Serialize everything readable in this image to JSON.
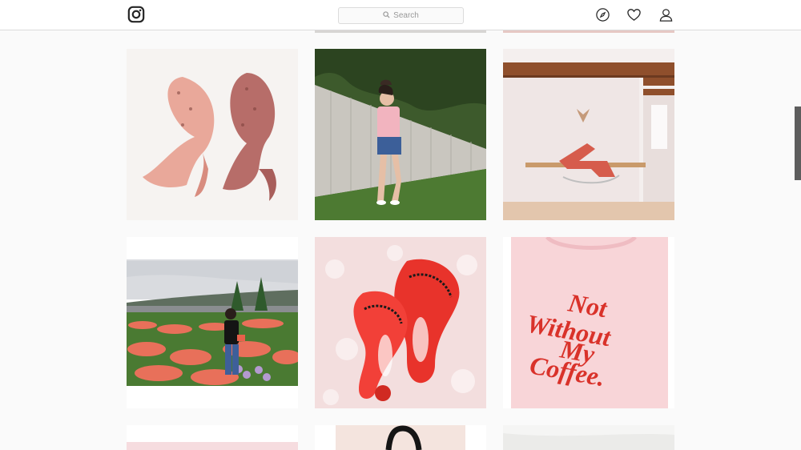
{
  "header": {
    "logo_icon": "instagram-logo-icon",
    "search_placeholder": "Search",
    "nav_icons": [
      "explore-icon",
      "heart-icon",
      "profile-icon"
    ]
  },
  "posts": [
    {
      "row": 1,
      "col": 1,
      "subject": "pink scarves"
    },
    {
      "row": 1,
      "col": 2,
      "subject": "woman by fence"
    },
    {
      "row": 1,
      "col": 3,
      "subject": "pink interior"
    },
    {
      "row": 2,
      "col": 1,
      "subject": "tulip field"
    },
    {
      "row": 2,
      "col": 2,
      "subject": "red sandals"
    },
    {
      "row": 2,
      "col": 3,
      "subject": "shirt text",
      "text_lines": [
        "Not",
        "Without",
        "My",
        "Coffee."
      ]
    }
  ],
  "colors": {
    "accent_red": "#d9322a",
    "border": "#dbdbdb",
    "background": "#fafafa"
  }
}
